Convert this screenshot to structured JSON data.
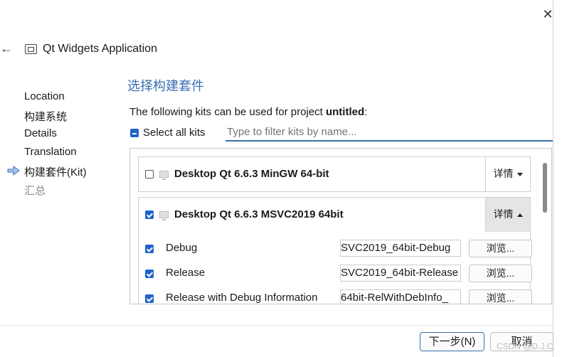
{
  "window": {
    "close_glyph": "✕"
  },
  "wizard": {
    "back_glyph": "←",
    "title": "Qt Widgets Application"
  },
  "sidebar": {
    "items": [
      {
        "label": "Location",
        "state": "done"
      },
      {
        "label": "构建系统",
        "state": "done"
      },
      {
        "label": "Details",
        "state": "done"
      },
      {
        "label": "Translation",
        "state": "done"
      },
      {
        "label": "构建套件(Kit)",
        "state": "current"
      },
      {
        "label": "汇总",
        "state": "pending"
      }
    ]
  },
  "page": {
    "heading": "选择构建套件",
    "description_prefix": "The following kits can be used for project ",
    "project_name": "untitled",
    "description_suffix": ":",
    "select_all_label": "Select all kits",
    "filter_placeholder": "Type to filter kits by name..."
  },
  "kits": [
    {
      "name": "Desktop Qt 6.6.3 MinGW 64-bit",
      "checked": false,
      "details_label": "详情",
      "expanded": false
    },
    {
      "name": "Desktop Qt 6.6.3 MSVC2019 64bit",
      "checked": true,
      "details_label": "详情",
      "expanded": true,
      "build_configs": [
        {
          "label": "Debug",
          "checked": true,
          "path": "SVC2019_64bit-Debug",
          "browse_label": "浏览..."
        },
        {
          "label": "Release",
          "checked": true,
          "path": "SVC2019_64bit-Release",
          "browse_label": "浏览..."
        },
        {
          "label": "Release with Debug Information",
          "checked": true,
          "path": "_64bit-RelWithDebInfo",
          "browse_label": "浏览..."
        }
      ]
    }
  ],
  "footer": {
    "next_label": "下一步(N)",
    "cancel_label": "取消",
    "watermark": "CSDN @D.J.C"
  },
  "colors": {
    "accent": "#1f64c8",
    "heading": "#3a6fb0"
  }
}
